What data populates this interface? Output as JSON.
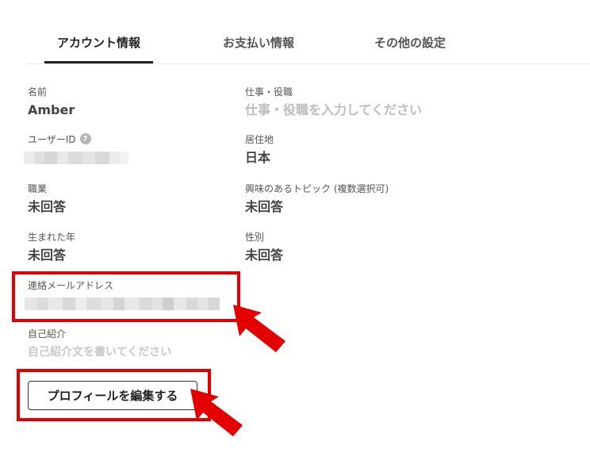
{
  "tabs": [
    {
      "label": "アカウント情報",
      "active": true
    },
    {
      "label": "お支払い情報",
      "active": false
    },
    {
      "label": "その他の設定",
      "active": false
    }
  ],
  "profile": {
    "name": {
      "label": "名前",
      "value": "Amber"
    },
    "job": {
      "label": "仕事・役職",
      "placeholder": "仕事・役職を入力してください"
    },
    "user_id": {
      "label": "ユーザーID",
      "help_glyph": "?"
    },
    "residence": {
      "label": "居住地",
      "value": "日本"
    },
    "occupation": {
      "label": "職業",
      "value": "未回答"
    },
    "interests": {
      "label": "興味のあるトピック (複数選択可)",
      "value": "未回答"
    },
    "birth_year": {
      "label": "生まれた年",
      "value": "未回答"
    },
    "gender": {
      "label": "性別",
      "value": "未回答"
    },
    "contact_email": {
      "label": "連絡メールアドレス"
    },
    "bio": {
      "label": "自己紹介",
      "placeholder": "自己紹介文を書いてください"
    }
  },
  "edit_button": {
    "label": "プロフィールを編集する"
  },
  "colors": {
    "highlight": "#e40000",
    "text": "#444444",
    "placeholder": "#bdbdbd"
  }
}
